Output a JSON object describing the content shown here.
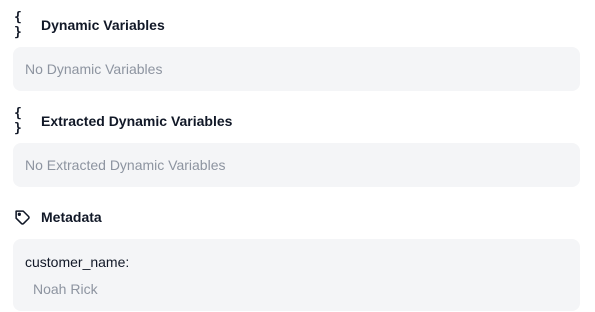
{
  "sections": {
    "dynamic_variables": {
      "title": "Dynamic Variables",
      "icon": "braces-icon",
      "icon_glyph": "{ }",
      "empty_text": "No Dynamic Variables"
    },
    "extracted_dynamic_variables": {
      "title": "Extracted Dynamic Variables",
      "icon": "braces-icon",
      "icon_glyph": "{ }",
      "empty_text": "No Extracted Dynamic Variables"
    },
    "metadata": {
      "title": "Metadata",
      "icon": "tag-icon",
      "entries": [
        {
          "key": "customer_name:",
          "value": "Noah Rick"
        }
      ]
    }
  },
  "colors": {
    "panel_background": "#f4f5f7",
    "muted_text": "#8d94a0",
    "primary_text": "#111827"
  }
}
